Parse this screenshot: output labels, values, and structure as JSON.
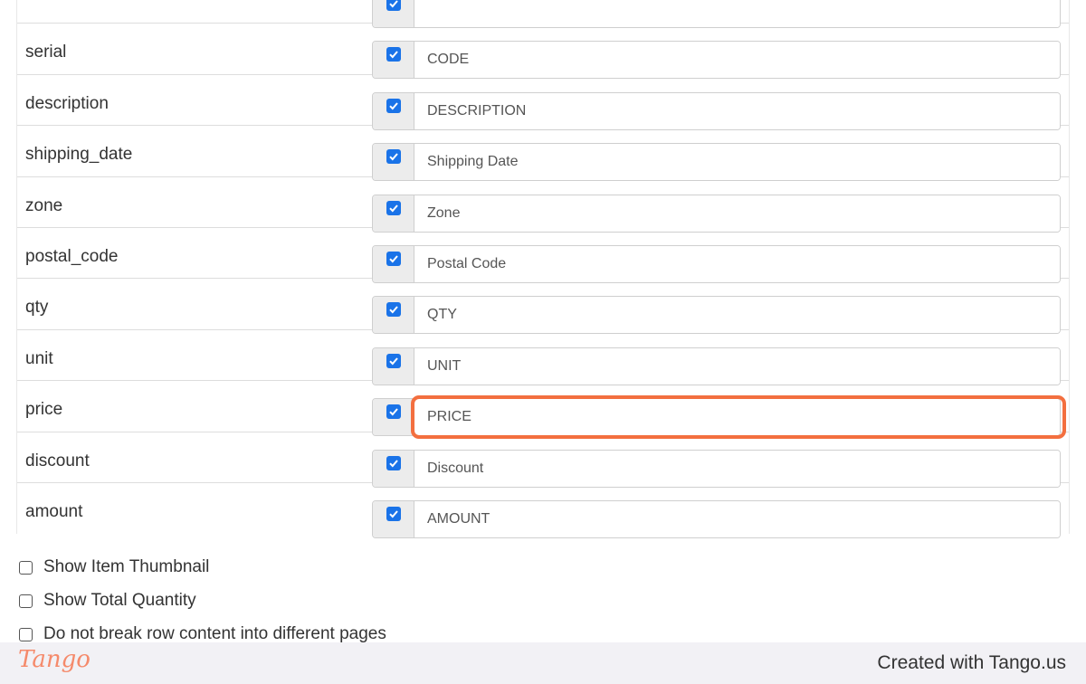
{
  "fields": [
    {
      "name": "",
      "value": "",
      "checked": true,
      "highlighted": false
    },
    {
      "name": "serial",
      "value": "CODE",
      "checked": true,
      "highlighted": false
    },
    {
      "name": "description",
      "value": "DESCRIPTION",
      "checked": true,
      "highlighted": false
    },
    {
      "name": "shipping_date",
      "value": "Shipping Date",
      "checked": true,
      "highlighted": false
    },
    {
      "name": "zone",
      "value": "Zone",
      "checked": true,
      "highlighted": false
    },
    {
      "name": "postal_code",
      "value": "Postal Code",
      "checked": true,
      "highlighted": false
    },
    {
      "name": "qty",
      "value": "QTY",
      "checked": true,
      "highlighted": false
    },
    {
      "name": "unit",
      "value": "UNIT",
      "checked": true,
      "highlighted": false
    },
    {
      "name": "price",
      "value": "PRICE",
      "checked": true,
      "highlighted": true
    },
    {
      "name": "discount",
      "value": "Discount",
      "checked": true,
      "highlighted": false
    },
    {
      "name": "amount",
      "value": "AMOUNT",
      "checked": true,
      "highlighted": false
    }
  ],
  "options": [
    {
      "label": "Show Item Thumbnail",
      "checked": false
    },
    {
      "label": "Show Total Quantity",
      "checked": false
    },
    {
      "label": "Do not break row content into different pages",
      "checked": false
    }
  ],
  "footer": {
    "logo": "Tango",
    "credit": "Created with Tango.us"
  },
  "colors": {
    "checkbox": "#1a73e8",
    "highlight": "#f36f3f",
    "logo": "#f58a6b"
  }
}
